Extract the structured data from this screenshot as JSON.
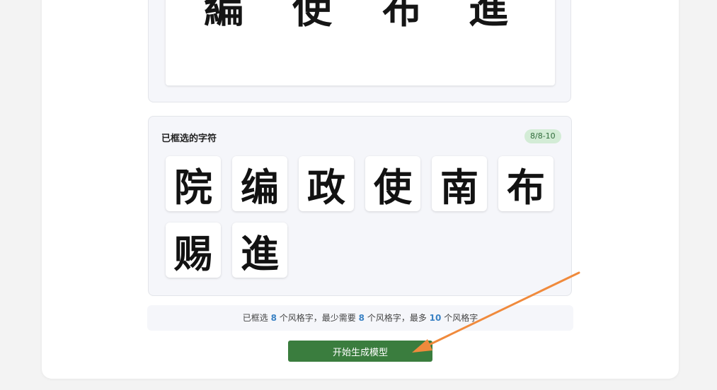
{
  "preview": {
    "characters": [
      "編",
      "使",
      "布",
      "進"
    ]
  },
  "selected": {
    "title": "已框选的字符",
    "badge": "8/8-10",
    "characters": [
      "院",
      "编",
      "政",
      "使",
      "南",
      "布",
      "赐",
      "進"
    ]
  },
  "info": {
    "prefix": "已框选",
    "selected_count": "8",
    "mid1": "个风格字，最少需要",
    "min_count": "8",
    "mid2": "个风格字，最多",
    "max_count": "10",
    "suffix": "个风格字"
  },
  "actions": {
    "start_label": "开始生成模型"
  },
  "colors": {
    "button_green": "#3a7d3e",
    "count_blue": "#3b82c4",
    "badge_bg": "#d3ecd6",
    "annotation_arrow": "#f08a3c"
  }
}
